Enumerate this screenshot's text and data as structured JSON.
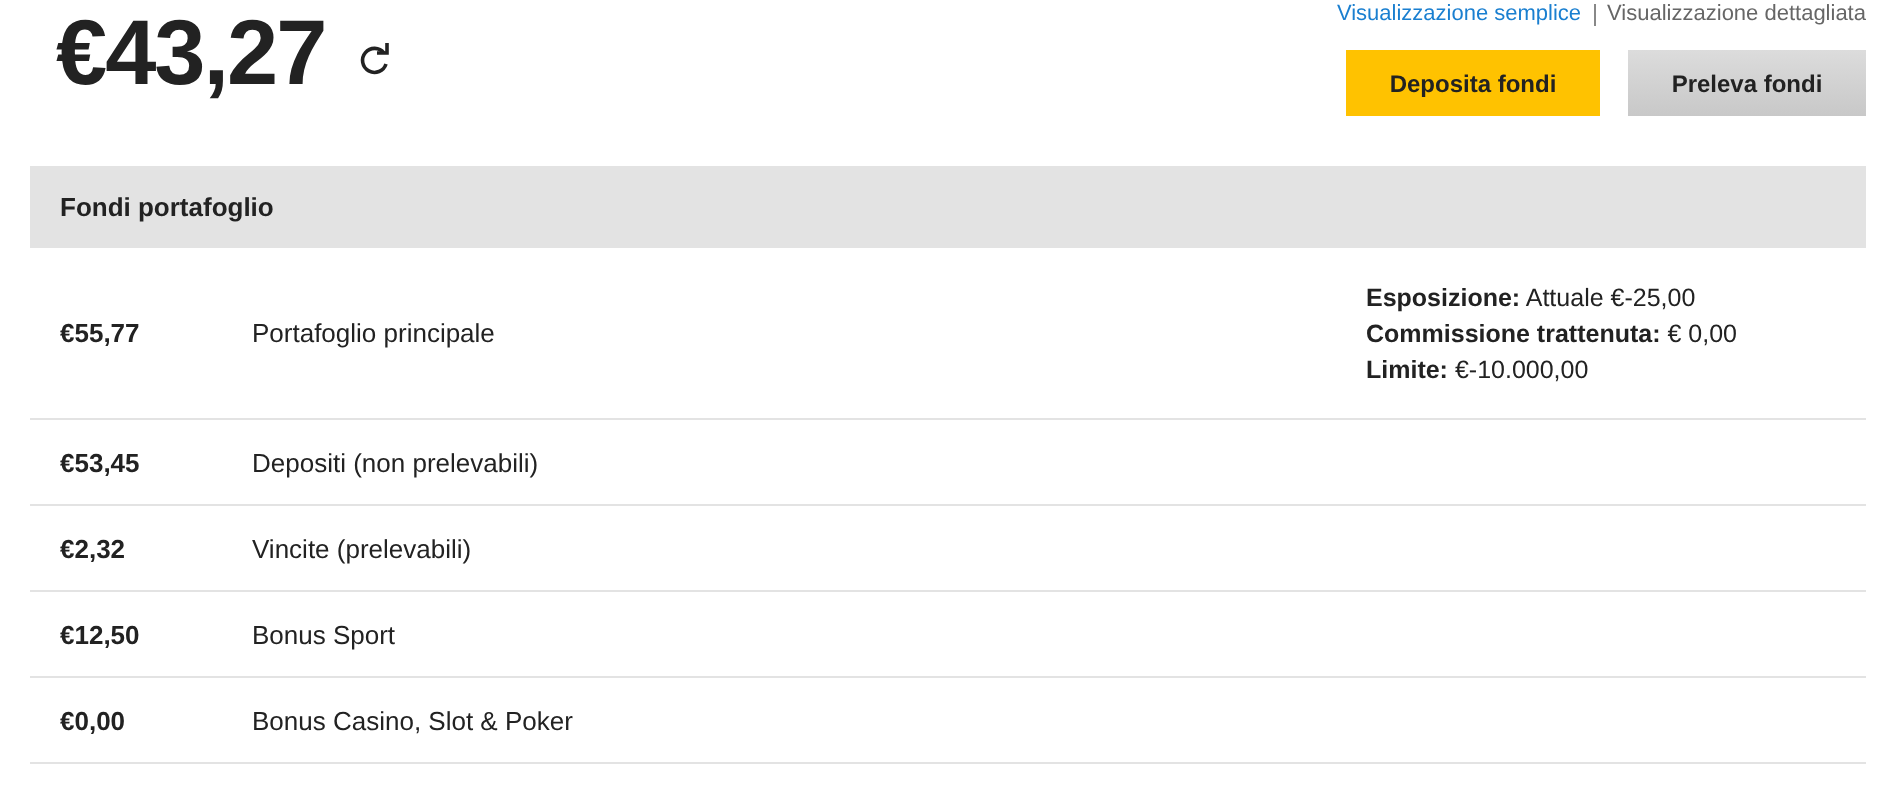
{
  "balance": {
    "amount": "€43,27"
  },
  "view_links": [
    {
      "label": "Visualizzazione semplice",
      "selected": false
    },
    {
      "label": "Visualizzazione dettagliata",
      "selected": true
    }
  ],
  "buttons": [
    {
      "label": "Deposita fondi",
      "kind": "primary"
    },
    {
      "label": "Preleva fondi",
      "kind": "secondary"
    }
  ],
  "wallet": {
    "title": "Fondi portafoglio",
    "rows": [
      {
        "amount": "€55,77",
        "label": "Portafoglio principale",
        "details": [
          "**Esposizione:** Attuale €-25,00",
          "**Commissione trattenuta:** € 0,00",
          "**Limite:** €-10.000,00"
        ]
      },
      {
        "amount": "€53,45",
        "label": "Depositi (non prelevabili)"
      },
      {
        "amount": "€2,32",
        "label": "Vincite (prelevabili)"
      },
      {
        "amount": "€12,50",
        "label": "Bonus Sport"
      },
      {
        "amount": "€0,00",
        "label": "Bonus Casino, Slot & Poker"
      }
    ]
  }
}
